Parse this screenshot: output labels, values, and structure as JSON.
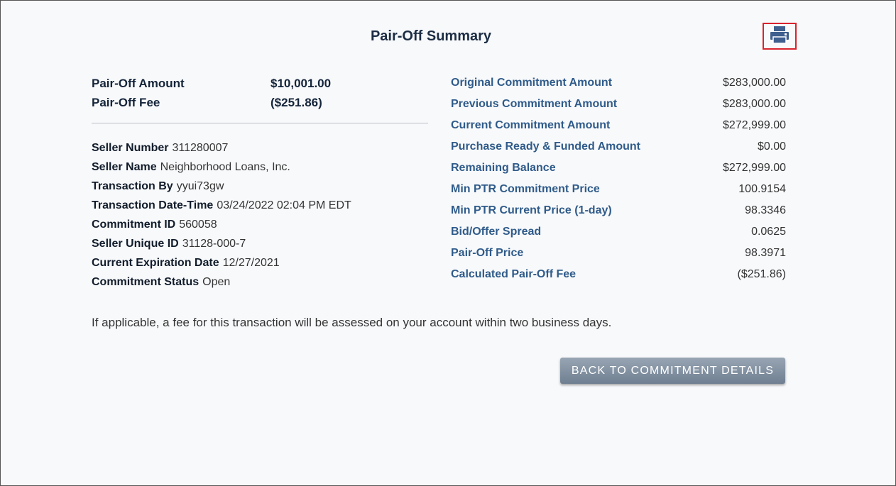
{
  "page": {
    "title": "Pair-Off Summary"
  },
  "toolbar": {
    "print_icon": "printer-icon",
    "print_border_color": "#d9232d"
  },
  "pair_off": {
    "amount_label": "Pair-Off Amount",
    "amount_value": "$10,001.00",
    "fee_label": "Pair-Off Fee",
    "fee_value": "($251.86)"
  },
  "details": [
    {
      "label": "Seller Number",
      "value": "311280007"
    },
    {
      "label": "Seller Name",
      "value": "Neighborhood Loans, Inc."
    },
    {
      "label": "Transaction By",
      "value": "yyui73gw"
    },
    {
      "label": "Transaction Date-Time",
      "value": "03/24/2022 02:04 PM EDT"
    },
    {
      "label": "Commitment ID",
      "value": "560058"
    },
    {
      "label": "Seller Unique ID",
      "value": "31128-000-7"
    },
    {
      "label": "Current Expiration Date",
      "value": "12/27/2021"
    },
    {
      "label": "Commitment Status",
      "value": "Open"
    }
  ],
  "summary": [
    {
      "label": "Original Commitment Amount",
      "value": "$283,000.00"
    },
    {
      "label": "Previous Commitment Amount",
      "value": "$283,000.00"
    },
    {
      "label": "Current Commitment Amount",
      "value": "$272,999.00"
    },
    {
      "label": "Purchase Ready & Funded Amount",
      "value": "$0.00"
    },
    {
      "label": "Remaining Balance",
      "value": "$272,999.00"
    },
    {
      "label": "Min PTR Commitment Price",
      "value": "100.9154"
    },
    {
      "label": "Min PTR Current Price (1-day)",
      "value": "98.3346"
    },
    {
      "label": "Bid/Offer Spread",
      "value": "0.0625"
    },
    {
      "label": "Pair-Off Price",
      "value": "98.3971"
    },
    {
      "label": "Calculated Pair-Off Fee",
      "value": "($251.86)"
    }
  ],
  "note": "If applicable, a fee for this transaction will be assessed on your account within two business days.",
  "actions": {
    "back_label": "BACK TO COMMITMENT DETAILS"
  }
}
